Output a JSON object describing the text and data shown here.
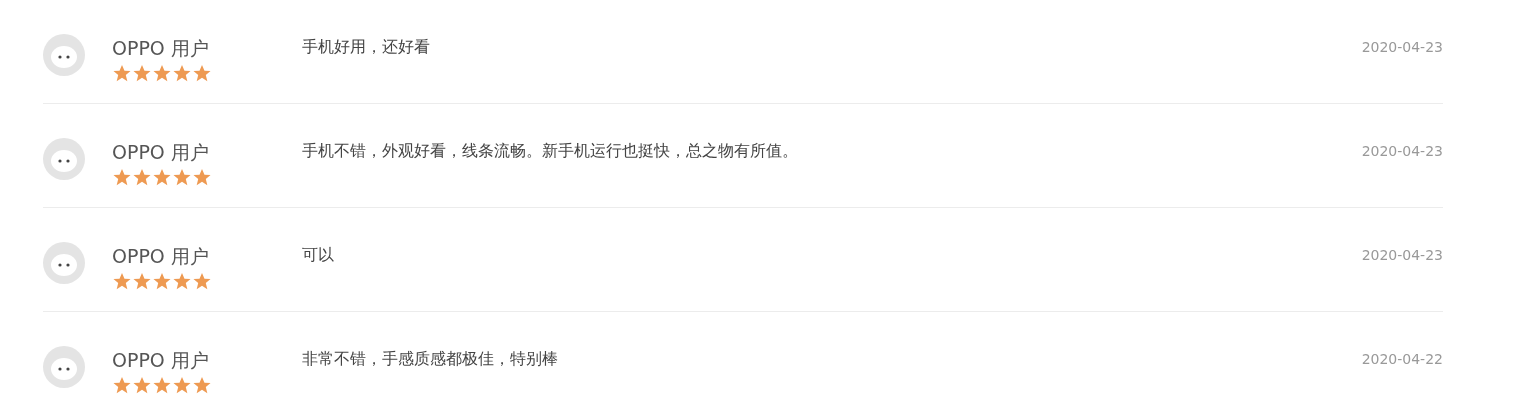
{
  "reviews": [
    {
      "user": "OPPO 用户",
      "stars": 5,
      "comment": "手机好用，还好看",
      "date": "2020-04-23"
    },
    {
      "user": "OPPO 用户",
      "stars": 5,
      "comment": "手机不错，外观好看，线条流畅。新手机运行也挺快，总之物有所值。",
      "date": "2020-04-23"
    },
    {
      "user": "OPPO 用户",
      "stars": 5,
      "comment": "可以",
      "date": "2020-04-23"
    },
    {
      "user": "OPPO 用户",
      "stars": 5,
      "comment": "非常不错，手感质感都极佳，特别棒",
      "date": "2020-04-22"
    }
  ]
}
